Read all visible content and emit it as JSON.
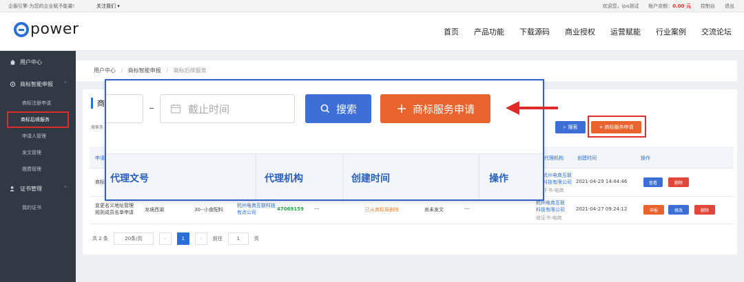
{
  "topbar": {
    "slogan": "企服引擎-为您的企业赋予能量!",
    "follow": "关注我们 ▾",
    "welcome": "欢迎您，ipa测试",
    "balance_label": "账户余额：",
    "balance": "0.00 元",
    "console": "控制台",
    "logout": "退出"
  },
  "header": {
    "logo": "power",
    "nav": [
      "首页",
      "产品功能",
      "下载源码",
      "商业授权",
      "运营赋能",
      "行业案例",
      "交流论坛"
    ]
  },
  "sidebar": {
    "user_center": "用户中心",
    "group1": "商标智能申报",
    "items1": [
      "商标注册申请",
      "商标后续服务",
      "申请人管理",
      "发文管理",
      "缴费管理"
    ],
    "group2": "证书管理",
    "items2": [
      "我的证书"
    ]
  },
  "breadcrumb": {
    "a": "用户中心",
    "b": "商标智能申报",
    "c": "商标后续服务",
    "sep": "/"
  },
  "panel": {
    "title": "商",
    "search_label": "搜索条",
    "search_btn": "搜索",
    "apply_btn": "+ 商标服务申请"
  },
  "table": {
    "head_first": "申请",
    "head_agency": "代理机构",
    "head_created": "创建时间",
    "head_ops": "操作",
    "rows": [
      {
        "name": "商标",
        "agency": "杭州电商互联科技有限公司",
        "sub": "下书-电商",
        "created": "2021-04-29 14:44:46",
        "ops": [
          "查看",
          "删除"
        ]
      },
      {
        "name": "变更名义地址管理规则成员名单申请",
        "region": "龙境西湖",
        "cls": "30--小食配料",
        "agent": "杭州电商互联科技有点公司",
        "num": "47069159",
        "d1": "---",
        "status": "已从商标局删除",
        "doc": "尚未发文",
        "d2": "---",
        "agency": "杭州电商互联科技有限公司",
        "sub": "收证书-电商",
        "created": "2021-04-27 09:24:12",
        "ops": [
          "申报",
          "修改",
          "删除"
        ]
      }
    ]
  },
  "pager": {
    "total": "共 2 条",
    "size": "20条/页",
    "prev": "‹",
    "page": "1",
    "next": "›",
    "goto": "前往",
    "goto_val": "1",
    "goto_suffix": "页"
  },
  "zoom": {
    "end_placeholder": "截止时间",
    "search": "搜索",
    "apply": "商标服务申请",
    "dash": "–",
    "cols": [
      "代理文号",
      "代理机构",
      "创建时间",
      "操作"
    ]
  },
  "colors": {
    "accent": "#2a6ed6",
    "apply": "#e8632e",
    "highlight": "#e02b2b",
    "sidebar": "#313944"
  }
}
